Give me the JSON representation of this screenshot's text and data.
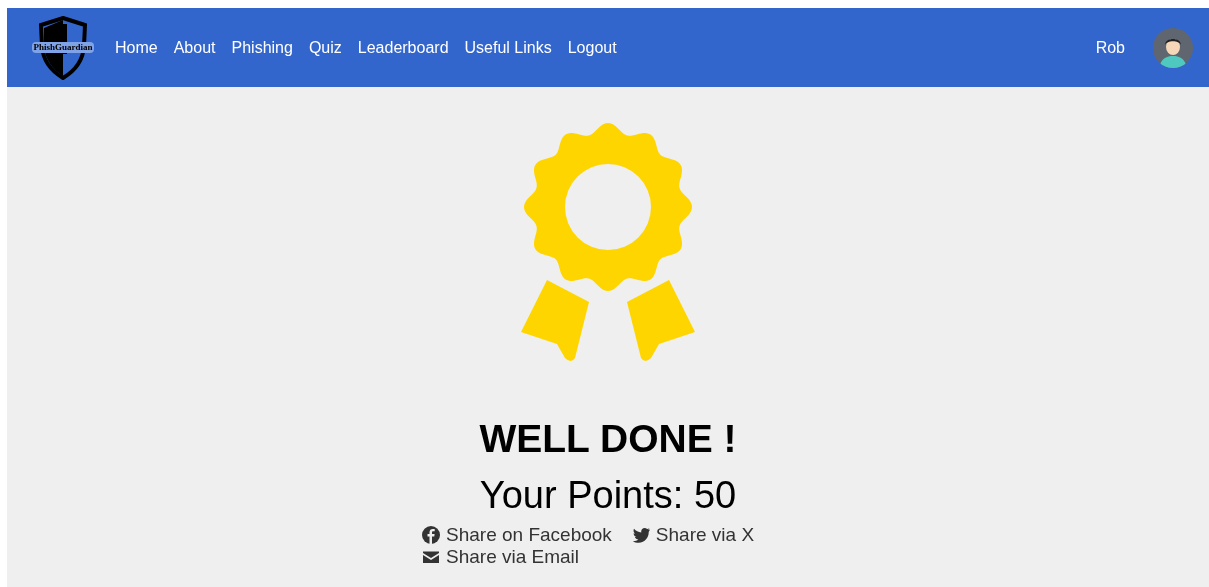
{
  "logo": {
    "text": "PhishGuardian"
  },
  "nav": [
    {
      "label": "Home"
    },
    {
      "label": "About"
    },
    {
      "label": "Phishing"
    },
    {
      "label": "Quiz"
    },
    {
      "label": "Leaderboard"
    },
    {
      "label": "Useful Links"
    },
    {
      "label": "Logout"
    }
  ],
  "user": {
    "name": "Rob"
  },
  "result": {
    "heading": "WELL DONE !",
    "points": "Your Points: 50"
  },
  "share": [
    {
      "kind": "facebook",
      "label": "Share on Facebook"
    },
    {
      "kind": "bird",
      "label": "Share via X"
    },
    {
      "kind": "email",
      "label": "Share via Email"
    }
  ]
}
